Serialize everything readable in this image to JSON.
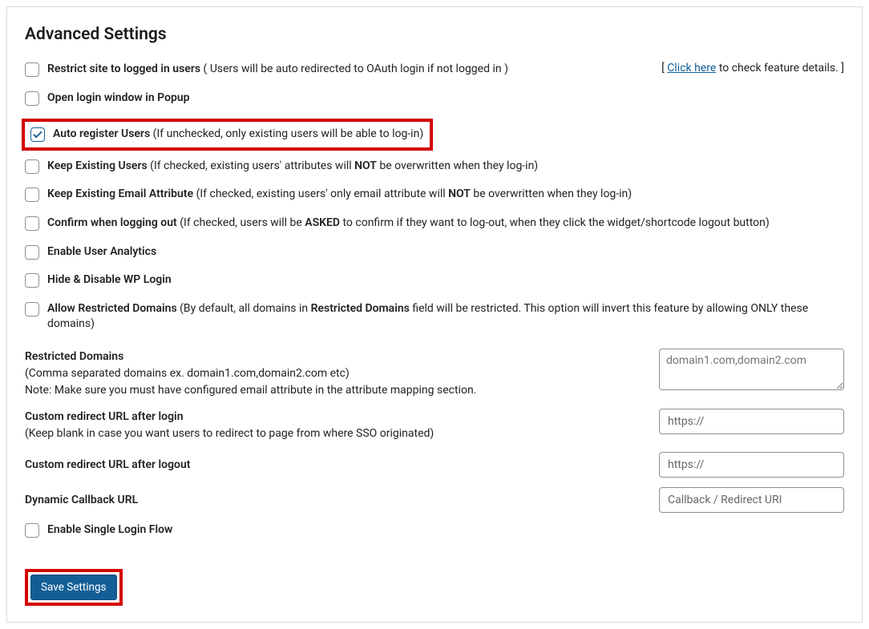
{
  "title": "Advanced Settings",
  "feature_link": {
    "prefix": "[ ",
    "link_text": "Click here",
    "suffix": " to check feature details. ]"
  },
  "options": {
    "restrict": {
      "label": "Restrict site to logged in users",
      "paren": " ( Users will be auto redirected to OAuth login if not logged in )"
    },
    "popup": {
      "label": "Open login window in Popup"
    },
    "auto_register": {
      "label": "Auto register Users",
      "paren": " (If unchecked, only existing users will be able to log-in)"
    },
    "keep_existing": {
      "label": "Keep Existing Users",
      "pre": " (If checked, existing users' attributes will ",
      "bold": "NOT",
      "post": " be overwritten when they log-in)"
    },
    "keep_email": {
      "label": "Keep Existing Email Attribute",
      "pre": " (If checked, existing users' only email attribute will ",
      "bold": "NOT",
      "post": " be overwritten when they log-in)"
    },
    "confirm_logout": {
      "label": "Confirm when logging out",
      "pre": " (If checked, users will be ",
      "bold": "ASKED",
      "post": " to confirm if they want to log-out, when they click the widget/shortcode logout button)"
    },
    "analytics": {
      "label": "Enable User Analytics"
    },
    "hide_wp_login": {
      "label": "Hide & Disable WP Login"
    },
    "allow_restricted": {
      "label": "Allow Restricted Domains",
      "pre": " (By default, all domains in ",
      "bold": "Restricted Domains",
      "post": " field will be restricted. This option will invert this feature by allowing ONLY these domains)"
    }
  },
  "restricted_domains": {
    "label": "Restricted Domains",
    "sub1": "(Comma separated domains ex. domain1.com,domain2.com etc)",
    "sub2": "Note: Make sure you must have configured email attribute in the attribute mapping section.",
    "placeholder": "domain1.com,domain2.com"
  },
  "redirect_login": {
    "label": "Custom redirect URL after login",
    "sub": "(Keep blank in case you want users to redirect to page from where SSO originated)",
    "placeholder": "https://"
  },
  "redirect_logout": {
    "label": "Custom redirect URL after logout",
    "placeholder": "https://"
  },
  "callback": {
    "label": "Dynamic Callback URL",
    "placeholder": "Callback / Redirect URI"
  },
  "single_login": {
    "label": "Enable Single Login Flow"
  },
  "save_button": "Save Settings"
}
